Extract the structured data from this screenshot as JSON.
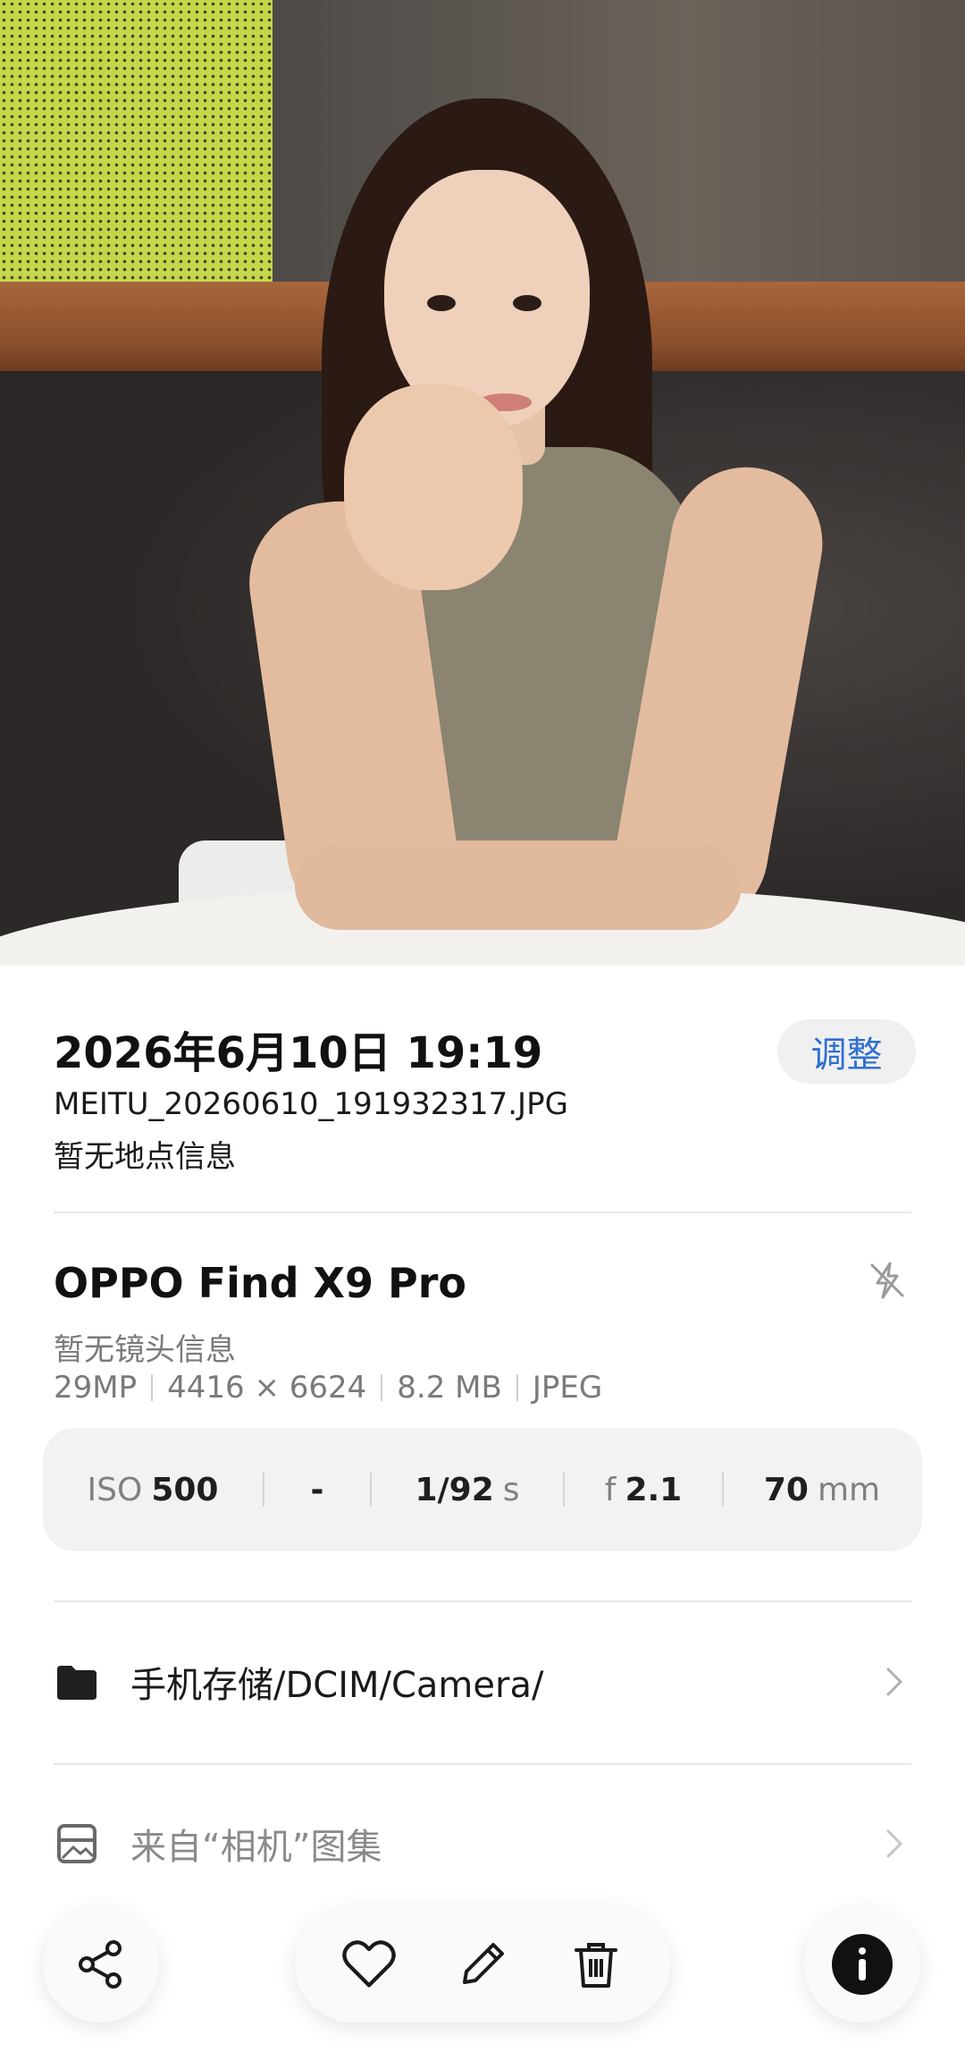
{
  "photo": {
    "description_icon": "portrait-photo"
  },
  "info": {
    "datetime": "2026年6月10日 19:19",
    "adjust_label": "调整",
    "filename": "MEITU_20260610_191932317.JPG",
    "location": "暂无地点信息"
  },
  "device": {
    "name": "OPPO Find X9 Pro",
    "lens": "暂无镜头信息",
    "specs": {
      "megapixels": "29MP",
      "resolution": "4416 × 6624",
      "size": "8.2 MB",
      "format": "JPEG"
    },
    "flash_icon": "flash-off-icon"
  },
  "exif": {
    "iso_label": "ISO",
    "iso_value": "500",
    "ev_value": "-",
    "shutter_value": "1/92",
    "shutter_unit": "s",
    "aperture_label": "f",
    "aperture_value": "2.1",
    "focal_value": "70",
    "focal_unit": "mm"
  },
  "rows": [
    {
      "icon": "folder-icon",
      "text": "手机存储/DCIM/Camera/"
    },
    {
      "icon": "album-icon",
      "text": "来自“相机”图集"
    }
  ],
  "bottom_bar": {
    "share_icon": "share-icon",
    "favorite_icon": "heart-icon",
    "edit_icon": "pencil-icon",
    "delete_icon": "trash-icon",
    "info_icon": "info-icon"
  },
  "colors": {
    "accent": "#2f6fd1",
    "muted_text": "#7a7a7a",
    "exif_bg": "#f2f2f2"
  }
}
